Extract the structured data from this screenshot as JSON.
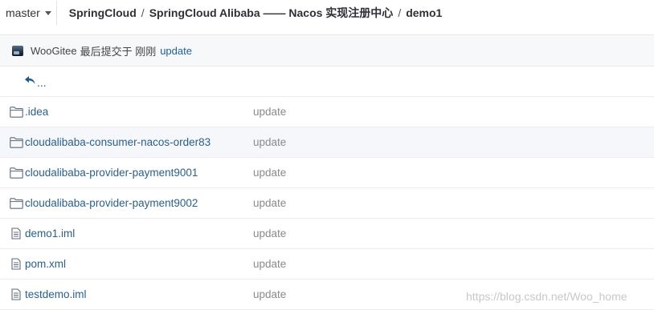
{
  "branch": {
    "label": "master"
  },
  "breadcrumb": {
    "items": [
      "SpringCloud",
      "SpringCloud Alibaba —— Nacos 实现注册中心",
      "demo1"
    ],
    "separator": "/"
  },
  "commit": {
    "user": "WooGitee",
    "text": "最后提交于 刚刚",
    "message": "update"
  },
  "back": {
    "label": "..."
  },
  "files": [
    {
      "name": ".idea",
      "type": "folder",
      "message": "update"
    },
    {
      "name": "cloudalibaba-consumer-nacos-order83",
      "type": "folder",
      "message": "update"
    },
    {
      "name": "cloudalibaba-provider-payment9001",
      "type": "folder",
      "message": "update"
    },
    {
      "name": "cloudalibaba-provider-payment9002",
      "type": "folder",
      "message": "update"
    },
    {
      "name": "demo1.iml",
      "type": "file",
      "message": "update"
    },
    {
      "name": "pom.xml",
      "type": "file",
      "message": "update"
    },
    {
      "name": "testdemo.iml",
      "type": "file",
      "message": "update"
    }
  ],
  "watermark": "https://blog.csdn.net/Woo_home",
  "colors": {
    "link": "#2b5f86",
    "accent": "#1e5f97",
    "muted": "#8a8a8a",
    "hover_row": "#f6f7fa"
  }
}
